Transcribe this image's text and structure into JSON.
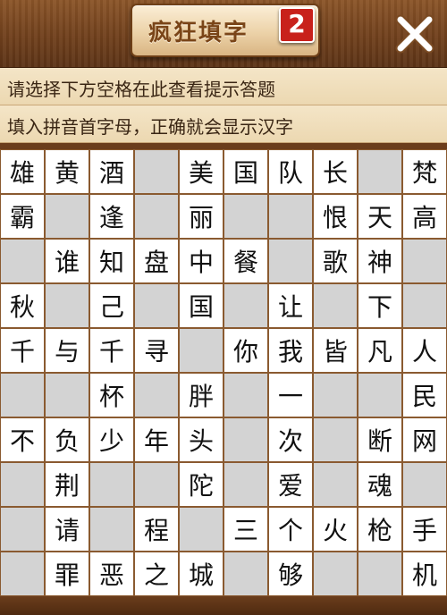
{
  "header": {
    "title": "疯狂填字",
    "badge": "2"
  },
  "hints": {
    "line1": "请选择下方空格在此查看提示答题",
    "line2": "填入拼音首字母，正确就会显示汉字"
  },
  "grid": {
    "rows": 10,
    "cols": 10,
    "cells": [
      [
        "雄",
        "黄",
        "酒",
        "",
        "美",
        "国",
        "队",
        "长",
        "",
        "梵"
      ],
      [
        "霸",
        "",
        "逢",
        "",
        "丽",
        "",
        "",
        "恨",
        "天",
        "高"
      ],
      [
        "",
        "谁",
        "知",
        "盘",
        "中",
        "餐",
        "",
        "歌",
        "神",
        ""
      ],
      [
        "秋",
        "",
        "己",
        "",
        "国",
        "",
        "让",
        "",
        "下",
        ""
      ],
      [
        "千",
        "与",
        "千",
        "寻",
        "",
        "你",
        "我",
        "皆",
        "凡",
        "人"
      ],
      [
        "",
        "",
        "杯",
        "",
        "胖",
        "",
        "一",
        "",
        "",
        "民"
      ],
      [
        "不",
        "负",
        "少",
        "年",
        "头",
        "",
        "次",
        "",
        "断",
        "网"
      ],
      [
        "",
        "荆",
        "",
        "",
        "陀",
        "",
        "爱",
        "",
        "魂",
        ""
      ],
      [
        "",
        "请",
        "",
        "程",
        "",
        "三",
        "个",
        "火",
        "枪",
        "手"
      ],
      [
        "",
        "罪",
        "恶",
        "之",
        "城",
        "",
        "够",
        "",
        "",
        "机"
      ]
    ]
  }
}
